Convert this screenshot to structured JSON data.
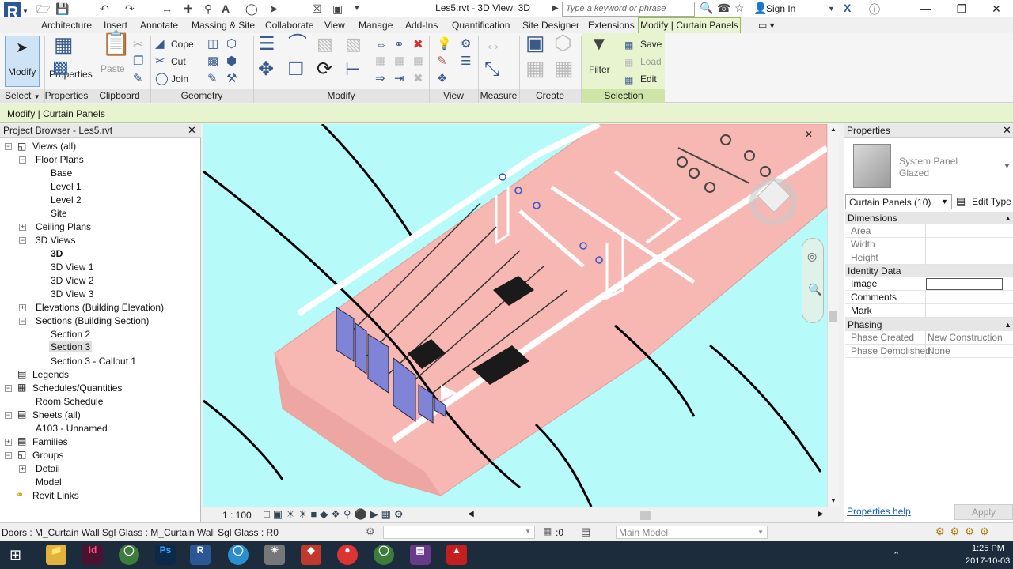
{
  "window": {
    "title": "Les5.rvt - 3D View: 3D",
    "search_placeholder": "Type a keyword or phrase",
    "sign_in": "Sign In"
  },
  "tabs": [
    "Architecture",
    "Insert",
    "Annotate",
    "Massing & Site",
    "Collaborate",
    "View",
    "Manage",
    "Add-Ins",
    "Quantification",
    "Site Designer",
    "Extensions"
  ],
  "active_tab": "Modify | Curtain Panels",
  "ribbon": {
    "modify_label": "Modify",
    "select_label": "Select",
    "properties_label": "Properties",
    "paste_label": "Paste",
    "clipboard_label": "Clipboard",
    "cope_label": "Cope",
    "cut_label": "Cut",
    "join_label": "Join",
    "geometry_label": "Geometry",
    "modify_panel_label": "Modify",
    "view_label": "View",
    "measure_label": "Measure",
    "create_label": "Create",
    "filter_label": "Filter",
    "save_label": "Save",
    "load_label": "Load",
    "edit_label": "Edit",
    "selection_label": "Selection"
  },
  "options_bar": "Modify | Curtain Panels",
  "project_browser": {
    "title": "Project Browser - Les5.rvt",
    "items": [
      {
        "label": "Views (all)"
      },
      {
        "label": "Floor Plans"
      },
      {
        "label": "Base"
      },
      {
        "label": "Level 1"
      },
      {
        "label": "Level 2"
      },
      {
        "label": "Site"
      },
      {
        "label": "Ceiling Plans"
      },
      {
        "label": "3D Views"
      },
      {
        "label": "3D"
      },
      {
        "label": "3D View 1"
      },
      {
        "label": "3D View 2"
      },
      {
        "label": "3D View 3"
      },
      {
        "label": "Elevations (Building Elevation)"
      },
      {
        "label": "Sections (Building Section)"
      },
      {
        "label": "Section 2"
      },
      {
        "label": "Section 3"
      },
      {
        "label": "Section 3 - Callout 1"
      },
      {
        "label": "Legends"
      },
      {
        "label": "Schedules/Quantities"
      },
      {
        "label": "Room Schedule"
      },
      {
        "label": "Sheets (all)"
      },
      {
        "label": "A103 - Unnamed"
      },
      {
        "label": "Families"
      },
      {
        "label": "Groups"
      },
      {
        "label": "Detail"
      },
      {
        "label": "Model"
      },
      {
        "label": "Revit Links"
      }
    ]
  },
  "properties": {
    "title": "Properties",
    "type_family": "System Panel",
    "type_name": "Glazed",
    "selector": "Curtain Panels (10)",
    "edit_type": "Edit Type",
    "sections": {
      "dimensions": "Dimensions",
      "identity": "Identity Data",
      "phasing": "Phasing"
    },
    "rows": {
      "area": "Area",
      "width": "Width",
      "height": "Height",
      "image": "Image",
      "comments": "Comments",
      "mark": "Mark",
      "phase_created": "Phase Created",
      "phase_created_value": "New Construction",
      "phase_demolished": "Phase Demolished",
      "phase_demolished_value": "None"
    },
    "help": "Properties help",
    "apply": "Apply"
  },
  "view_bar": {
    "scale": "1 : 100"
  },
  "status": {
    "text": "Doors : M_Curtain Wall Sgl Glass : M_Curtain Wall Sgl Glass : R0",
    "zero": ":0",
    "model": "Main Model"
  },
  "taskbar": {
    "time": "1:25 PM",
    "date": "2017-10-03"
  },
  "colors": {
    "floor": "#f7b7b3",
    "sky": "#b6fafa",
    "accent": "#2b5797",
    "contextual": "#e8f3d0"
  }
}
